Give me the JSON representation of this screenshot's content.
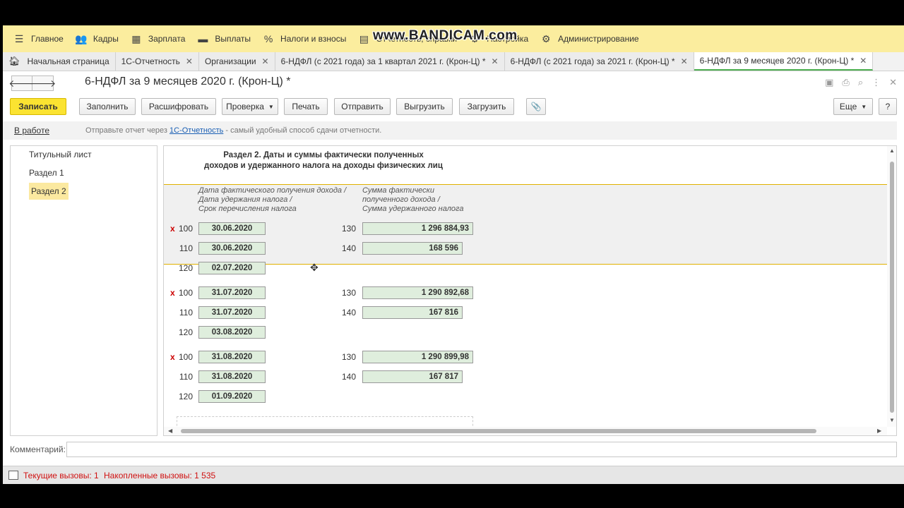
{
  "watermark": "www.BANDICAM.com",
  "menu": [
    {
      "icon": "hamburger-icon",
      "glyph": "☰",
      "label": "Главное"
    },
    {
      "icon": "people-icon",
      "glyph": "👥",
      "label": "Кадры"
    },
    {
      "icon": "calculator-icon",
      "glyph": "▦",
      "label": "Зарплата"
    },
    {
      "icon": "wallet-icon",
      "glyph": "▬",
      "label": "Выплаты"
    },
    {
      "icon": "percent-icon",
      "glyph": "%",
      "label": "Налоги и взносы"
    },
    {
      "icon": "report-icon",
      "glyph": "▤",
      "label": "Отчетность, справки"
    },
    {
      "icon": "settings-icon",
      "glyph": "⚙",
      "label": "Настройка"
    },
    {
      "icon": "gear-icon",
      "glyph": "⚙",
      "label": "Администрирование"
    }
  ],
  "tabs": [
    {
      "label": "Начальная страница",
      "close": ""
    },
    {
      "label": "1С-Отчетность",
      "close": "✕"
    },
    {
      "label": "Организации",
      "close": "✕"
    },
    {
      "label": "6-НДФЛ (с 2021 года) за 1 квартал 2021 г. (Крон-Ц) *",
      "close": "✕"
    },
    {
      "label": "6-НДФЛ (с 2021 года) за 2021 г. (Крон-Ц) *",
      "close": "✕"
    },
    {
      "label": "6-НДФЛ за 9 месяцев 2020 г. (Крон-Ц) *",
      "close": "✕"
    }
  ],
  "form": {
    "back": "🡐",
    "forward": "🡒",
    "title": "6-НДФЛ за 9 месяцев 2020 г. (Крон-Ц) *",
    "icons": {
      "save": "▣",
      "print": "⎙",
      "preview": "⌕",
      "more": "⋮",
      "close": "✕"
    }
  },
  "toolbar": {
    "save": "Записать",
    "fill": "Заполнить",
    "decode": "Расшифровать",
    "check": "Проверка",
    "print": "Печать",
    "send": "Отправить",
    "export": "Выгрузить",
    "import": "Загрузить",
    "attach": "📎",
    "more": "Еще",
    "help": "?",
    "dd_arrow": "▼"
  },
  "info": {
    "status": "В работе",
    "text_before": "Отправьте отчет через ",
    "link": "1С-Отчетность",
    "text_after": " - самый удобный способ сдачи отчетности."
  },
  "left_panel": [
    "Титульный лист",
    "Раздел 1",
    "Раздел 2"
  ],
  "doc": {
    "title_line1": "Раздел 2.  Даты и суммы фактически полученных",
    "title_line2": "доходов и удержанного налога на доходы физических лиц",
    "hdr_dates": [
      "Дата фактического получения дохода /",
      "Дата удержания налога /",
      "Срок перечисления налога"
    ],
    "hdr_sums": [
      "Сумма фактически",
      "полученного дохода /",
      "Сумма удержанного налога"
    ],
    "error_mark": "x",
    "blocks": [
      {
        "d100": "30.06.2020",
        "d110": "30.06.2020",
        "d120": "02.07.2020",
        "s130": "1 296 884,93",
        "s140": "168 596"
      },
      {
        "d100": "31.07.2020",
        "d110": "31.07.2020",
        "d120": "03.08.2020",
        "s130": "1 290 892,68",
        "s140": "167 816"
      },
      {
        "d100": "31.08.2020",
        "d110": "31.08.2020",
        "d120": "01.09.2020",
        "s130": "1 290 899,98",
        "s140": "167 817"
      }
    ],
    "codes": {
      "c100": "100",
      "c110": "110",
      "c120": "120",
      "c130": "130",
      "c140": "140"
    }
  },
  "comment": {
    "label": "Комментарий:",
    "value": ""
  },
  "status": {
    "current": "Текущие вызовы: 1",
    "total": "Накопленные вызовы: 1 535"
  },
  "colors": {
    "menubar": "#fbed9e",
    "primary_button": "#fbe331",
    "field_bg": "#dfeedd",
    "error": "#cc0000"
  }
}
